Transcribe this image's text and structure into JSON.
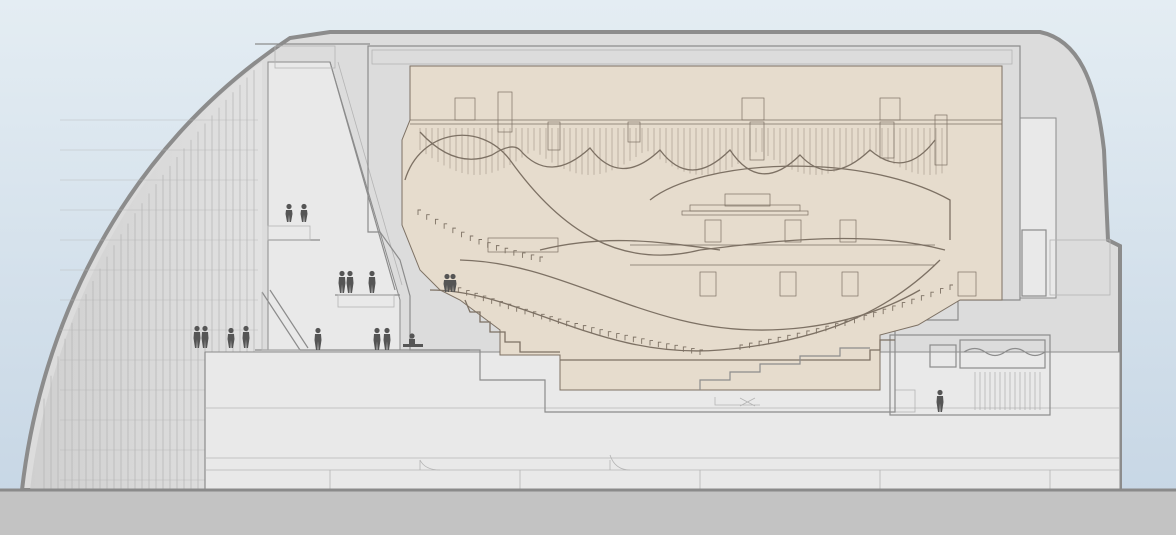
{
  "drawing": {
    "kind": "architectural-section",
    "subject": "concert-hall",
    "colors": {
      "sky_top": "#e4edf3",
      "sky_bottom": "#c5d5e4",
      "ground": "#c3c3c3",
      "ground_line": "#8a8a8a",
      "building_fill": "#dcdcdc",
      "building_light": "#e9e9e9",
      "building_outline": "#8c8c8c",
      "facade_lines": "#b4b4b4",
      "hall_fill": "#e6dccd",
      "hall_line": "#7d7164",
      "hall_frame": "#fbfbfb",
      "figures": "#555555"
    },
    "elements": {
      "people_groups": 9,
      "escalators": 1,
      "balcony_tiers": 3,
      "canopy_scallops": 7
    }
  }
}
